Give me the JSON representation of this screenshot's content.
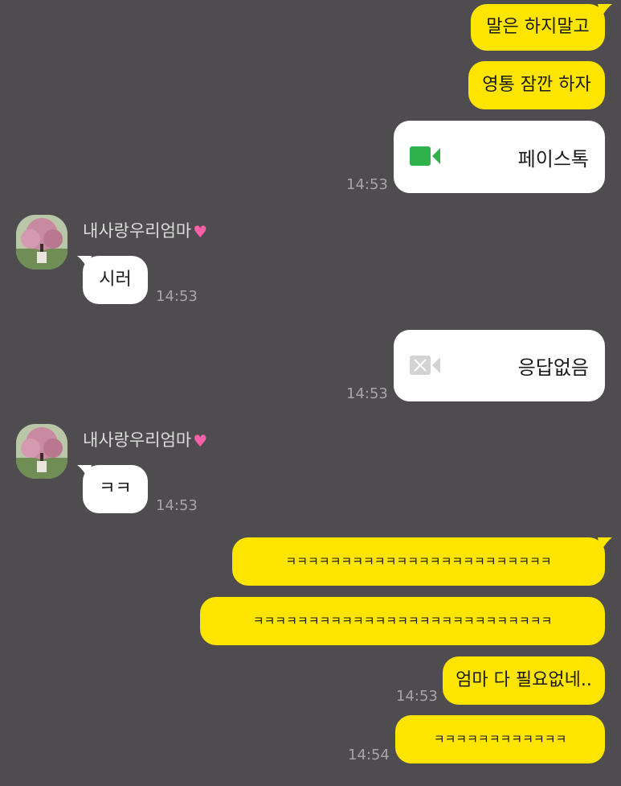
{
  "messages": {
    "m1": {
      "text": "말은 하지말고"
    },
    "m2": {
      "text": "영통 잠깐 하자"
    },
    "call1": {
      "label": "페이스톡",
      "time": "14:53",
      "status_color": "#2fb24c"
    },
    "in1": {
      "sender": "내사랑우리엄마",
      "text": "시러",
      "time": "14:53"
    },
    "call2": {
      "label": "응답없음",
      "time": "14:53",
      "status_color": "#d3d3d3"
    },
    "in2": {
      "sender": "내사랑우리엄마",
      "text": "ㅋㅋ",
      "time": "14:53"
    },
    "m3": {
      "text": "ㅋㅋㅋㅋㅋㅋㅋㅋㅋㅋㅋㅋㅋㅋㅋㅋㅋㅋㅋㅋㅋㅋㅋㅋ"
    },
    "m4": {
      "text": "ㅋㅋㅋㅋㅋㅋㅋㅋㅋㅋㅋㅋㅋㅋㅋㅋㅋㅋㅋㅋㅋㅋㅋㅋㅋㅋㅋ"
    },
    "m5": {
      "text": "엄마 다 필요없네..",
      "time": "14:53"
    },
    "m6": {
      "text": "ㅋㅋㅋㅋㅋㅋㅋㅋㅋㅋㅋㅋ",
      "time": "14:54"
    }
  },
  "colors": {
    "background": "#4e4c4e",
    "outgoing_bubble": "#fee500",
    "incoming_bubble": "#ffffff",
    "timestamp": "#a7a5a7"
  },
  "icons": {
    "sender_emoji": "pink-heart-emoji",
    "call_icon": "video-camera-icon"
  }
}
